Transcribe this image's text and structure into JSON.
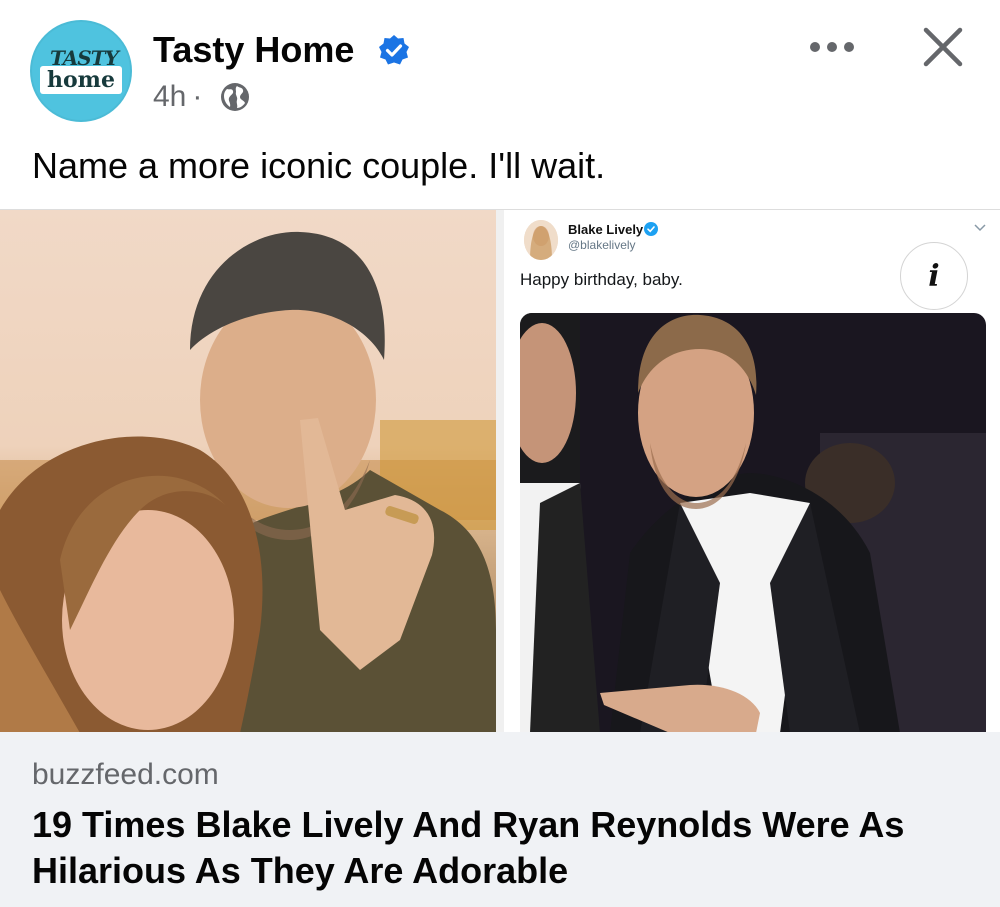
{
  "header": {
    "avatar": {
      "line1": "TASTY",
      "line2": "home"
    },
    "page_name": "Tasty Home",
    "time": "4h",
    "separator": "·",
    "icons": {
      "verified": "verified-badge-icon",
      "audience": "globe-icon",
      "more": "more-options-icon",
      "close": "close-icon"
    },
    "colors": {
      "verified": "#1b74e4",
      "avatar_bg": "#4fc3df"
    }
  },
  "post": {
    "text": "Name a more iconic couple. I'll wait."
  },
  "media": {
    "tweet": {
      "name": "Blake Lively",
      "handle": "@blakelively",
      "text": "Happy birthday, baby."
    },
    "info_button": "i"
  },
  "link_preview": {
    "domain": "buzzfeed.com",
    "headline": "19 Times Blake Lively And Ryan Reynolds Were As Hilarious As They Are Adorable"
  }
}
